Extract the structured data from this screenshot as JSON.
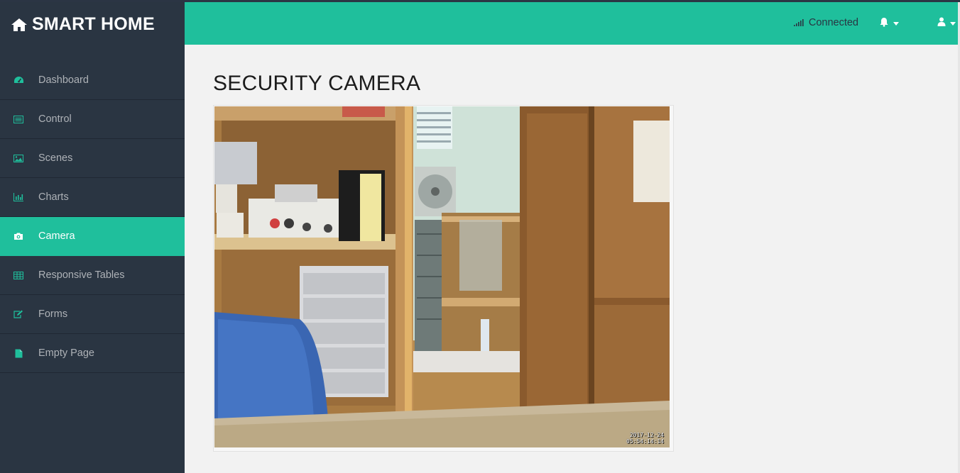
{
  "app": {
    "brand": "SMART HOME",
    "brand_icon": "home-icon"
  },
  "sidebar": {
    "items": [
      {
        "label": "Dashboard",
        "icon": "dashboard-icon",
        "active": false
      },
      {
        "label": "Control",
        "icon": "list-icon",
        "active": false
      },
      {
        "label": "Scenes",
        "icon": "image-icon",
        "active": false
      },
      {
        "label": "Charts",
        "icon": "bar-chart-icon",
        "active": false
      },
      {
        "label": "Camera",
        "icon": "camera-icon",
        "active": true
      },
      {
        "label": "Responsive Tables",
        "icon": "table-icon",
        "active": false
      },
      {
        "label": "Forms",
        "icon": "edit-icon",
        "active": false
      },
      {
        "label": "Empty Page",
        "icon": "file-icon",
        "active": false
      }
    ]
  },
  "header": {
    "status_text": "Connected",
    "status_icon": "signal-icon",
    "notifications_icon": "bell-icon",
    "user_icon": "user-icon"
  },
  "main": {
    "page_title": "SECURITY CAMERA",
    "camera": {
      "timestamp_date": "2017-12-24",
      "timestamp_time": "05:54:14:14"
    }
  },
  "colors": {
    "accent": "#1fbf9c",
    "sidebar_bg": "#2a3542",
    "content_bg": "#f2f2f2"
  }
}
